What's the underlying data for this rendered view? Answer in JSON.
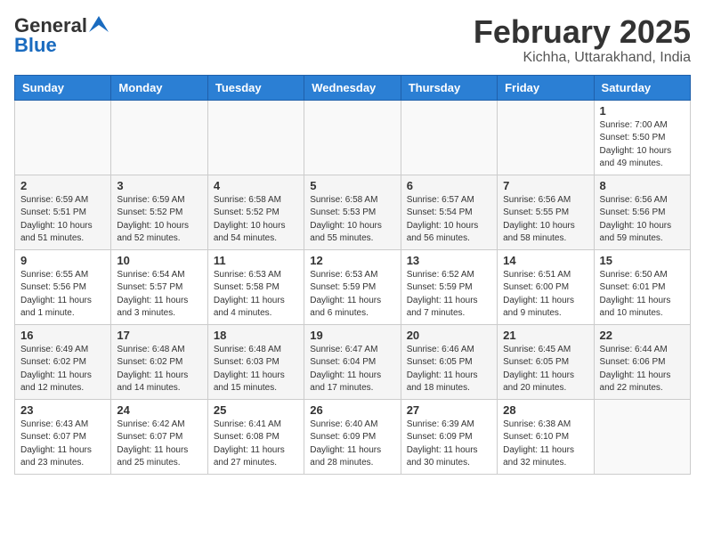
{
  "header": {
    "logo_general": "General",
    "logo_blue": "Blue",
    "month_title": "February 2025",
    "location": "Kichha, Uttarakhand, India"
  },
  "days_of_week": [
    "Sunday",
    "Monday",
    "Tuesday",
    "Wednesday",
    "Thursday",
    "Friday",
    "Saturday"
  ],
  "weeks": [
    [
      {
        "day": "",
        "info": ""
      },
      {
        "day": "",
        "info": ""
      },
      {
        "day": "",
        "info": ""
      },
      {
        "day": "",
        "info": ""
      },
      {
        "day": "",
        "info": ""
      },
      {
        "day": "",
        "info": ""
      },
      {
        "day": "1",
        "info": "Sunrise: 7:00 AM\nSunset: 5:50 PM\nDaylight: 10 hours and 49 minutes."
      }
    ],
    [
      {
        "day": "2",
        "info": "Sunrise: 6:59 AM\nSunset: 5:51 PM\nDaylight: 10 hours and 51 minutes."
      },
      {
        "day": "3",
        "info": "Sunrise: 6:59 AM\nSunset: 5:52 PM\nDaylight: 10 hours and 52 minutes."
      },
      {
        "day": "4",
        "info": "Sunrise: 6:58 AM\nSunset: 5:52 PM\nDaylight: 10 hours and 54 minutes."
      },
      {
        "day": "5",
        "info": "Sunrise: 6:58 AM\nSunset: 5:53 PM\nDaylight: 10 hours and 55 minutes."
      },
      {
        "day": "6",
        "info": "Sunrise: 6:57 AM\nSunset: 5:54 PM\nDaylight: 10 hours and 56 minutes."
      },
      {
        "day": "7",
        "info": "Sunrise: 6:56 AM\nSunset: 5:55 PM\nDaylight: 10 hours and 58 minutes."
      },
      {
        "day": "8",
        "info": "Sunrise: 6:56 AM\nSunset: 5:56 PM\nDaylight: 10 hours and 59 minutes."
      }
    ],
    [
      {
        "day": "9",
        "info": "Sunrise: 6:55 AM\nSunset: 5:56 PM\nDaylight: 11 hours and 1 minute."
      },
      {
        "day": "10",
        "info": "Sunrise: 6:54 AM\nSunset: 5:57 PM\nDaylight: 11 hours and 3 minutes."
      },
      {
        "day": "11",
        "info": "Sunrise: 6:53 AM\nSunset: 5:58 PM\nDaylight: 11 hours and 4 minutes."
      },
      {
        "day": "12",
        "info": "Sunrise: 6:53 AM\nSunset: 5:59 PM\nDaylight: 11 hours and 6 minutes."
      },
      {
        "day": "13",
        "info": "Sunrise: 6:52 AM\nSunset: 5:59 PM\nDaylight: 11 hours and 7 minutes."
      },
      {
        "day": "14",
        "info": "Sunrise: 6:51 AM\nSunset: 6:00 PM\nDaylight: 11 hours and 9 minutes."
      },
      {
        "day": "15",
        "info": "Sunrise: 6:50 AM\nSunset: 6:01 PM\nDaylight: 11 hours and 10 minutes."
      }
    ],
    [
      {
        "day": "16",
        "info": "Sunrise: 6:49 AM\nSunset: 6:02 PM\nDaylight: 11 hours and 12 minutes."
      },
      {
        "day": "17",
        "info": "Sunrise: 6:48 AM\nSunset: 6:02 PM\nDaylight: 11 hours and 14 minutes."
      },
      {
        "day": "18",
        "info": "Sunrise: 6:48 AM\nSunset: 6:03 PM\nDaylight: 11 hours and 15 minutes."
      },
      {
        "day": "19",
        "info": "Sunrise: 6:47 AM\nSunset: 6:04 PM\nDaylight: 11 hours and 17 minutes."
      },
      {
        "day": "20",
        "info": "Sunrise: 6:46 AM\nSunset: 6:05 PM\nDaylight: 11 hours and 18 minutes."
      },
      {
        "day": "21",
        "info": "Sunrise: 6:45 AM\nSunset: 6:05 PM\nDaylight: 11 hours and 20 minutes."
      },
      {
        "day": "22",
        "info": "Sunrise: 6:44 AM\nSunset: 6:06 PM\nDaylight: 11 hours and 22 minutes."
      }
    ],
    [
      {
        "day": "23",
        "info": "Sunrise: 6:43 AM\nSunset: 6:07 PM\nDaylight: 11 hours and 23 minutes."
      },
      {
        "day": "24",
        "info": "Sunrise: 6:42 AM\nSunset: 6:07 PM\nDaylight: 11 hours and 25 minutes."
      },
      {
        "day": "25",
        "info": "Sunrise: 6:41 AM\nSunset: 6:08 PM\nDaylight: 11 hours and 27 minutes."
      },
      {
        "day": "26",
        "info": "Sunrise: 6:40 AM\nSunset: 6:09 PM\nDaylight: 11 hours and 28 minutes."
      },
      {
        "day": "27",
        "info": "Sunrise: 6:39 AM\nSunset: 6:09 PM\nDaylight: 11 hours and 30 minutes."
      },
      {
        "day": "28",
        "info": "Sunrise: 6:38 AM\nSunset: 6:10 PM\nDaylight: 11 hours and 32 minutes."
      },
      {
        "day": "",
        "info": ""
      }
    ]
  ]
}
